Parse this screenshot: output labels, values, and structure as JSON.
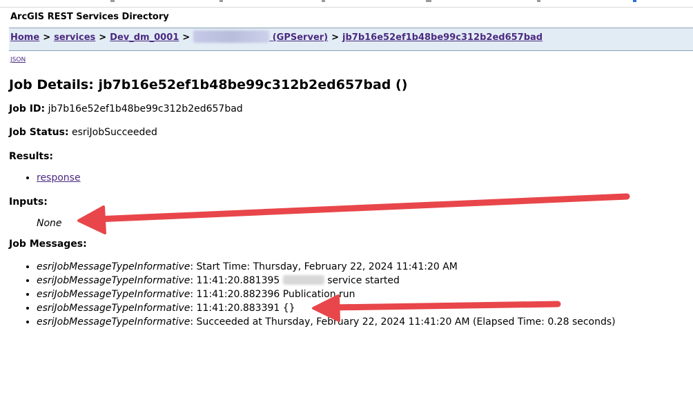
{
  "header": {
    "title": "ArcGIS REST Services Directory"
  },
  "breadcrumb": {
    "home": "Home",
    "services": "services",
    "folder": "Dev_dm_0001",
    "server_type": "(GPServer)",
    "job": "jb7b16e52ef1b48be99c312b2ed657bad",
    "separator": ">"
  },
  "json_link": "JSON",
  "title": "Job Details: jb7b16e52ef1b48be99c312b2ed657bad ()",
  "job_id": {
    "label": "Job ID:",
    "value": "jb7b16e52ef1b48be99c312b2ed657bad"
  },
  "job_status": {
    "label": "Job Status:",
    "value": "esriJobSucceeded"
  },
  "results": {
    "label": "Results:",
    "items": [
      "response"
    ]
  },
  "inputs": {
    "label": "Inputs:",
    "value": "None"
  },
  "messages": {
    "label": "Job Messages:",
    "items": [
      {
        "type": "esriJobMessageTypeInformative",
        "text": "Start Time: Thursday, February 22, 2024 11:41:20 AM"
      },
      {
        "type": "esriJobMessageTypeInformative",
        "text_before": "11:41:20.881395",
        "text_after": "service started"
      },
      {
        "type": "esriJobMessageTypeInformative",
        "text": "11:41:20.882396 Publication run"
      },
      {
        "type": "esriJobMessageTypeInformative",
        "text": "11:41:20.883391 {}"
      },
      {
        "type": "esriJobMessageTypeInformative",
        "text": "Succeeded at Thursday, February 22, 2024 11:41:20 AM (Elapsed Time: 0.28 seconds)"
      }
    ]
  },
  "colors": {
    "link": "#4b2a80",
    "nav_background": "#e2ecf5",
    "annotation_arrow": "#e8464a"
  },
  "icons": [
    "annotation-arrow"
  ]
}
